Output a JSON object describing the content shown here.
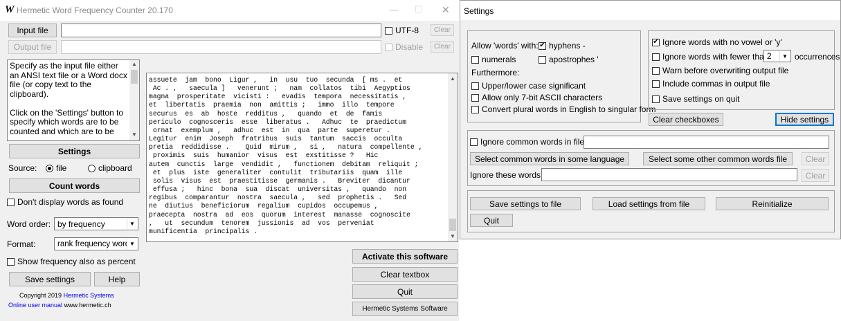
{
  "main_window": {
    "title": "Hermetic Word Frequency Counter 20.170",
    "app_icon_glyph": "W",
    "input_file_label": "Input file",
    "output_file_label": "Output file",
    "utf8_label": "UTF-8",
    "disable_label": "Disable",
    "clear_label": "Clear",
    "help_text": "Specify as the input file either an ANSI text file or a Word docx file (or copy text to the clipboard).\n\nClick on the 'Settings' button to specify which words are to be counted and which are to be",
    "settings_button": "Settings",
    "source_label": "Source:",
    "source_file": "file",
    "source_clipboard": "clipboard",
    "count_words_button": "Count words",
    "dont_display_label": "Don't display words as found",
    "word_order_label": "Word order:",
    "word_order_value": "by frequency",
    "format_label": "Format:",
    "format_value": "rank frequency word",
    "show_percent_label": "Show frequency also as percent",
    "save_settings_button": "Save settings",
    "help_button": "Help",
    "copyright_prefix": "Copyright 2019",
    "copyright_link": "Hermetic Systems",
    "manual_link": "Online user manual",
    "website": "www.hermetic.ch",
    "text_lines": [
      "assuete  jam  bono  Ligur ,   in  usu  tuo  secunda  [ ms .  et",
      " Ac . ,   saecula ]   venerunt ;   nam  collatos  tibi  Aegyptios",
      "magna  prosperitate  vicisti :   evadis  tempora  necessitatis ,",
      "et  libertatis  praemia  non  amittis ;   immo  illo  tempore",
      "securus  es  ab  hoste  redditus ,   quando  et  de  famis",
      "periculo  cognosceris  esse  liberatus .   Adhuc  te  praedictum",
      " ornat  exemplum ,   adhuc  est  in  qua  parte  superetur .",
      "Legitur  enim  Joseph  fratribus  suis  tantum  saccis  occulta",
      "pretia  reddidisse .    Quid  mirum ,   si ,   natura  compellente ,",
      " proximis  suis  humanior  visus  est  exstitisse ?   Hic",
      "autem  cunctis  large  vendidit ,   functionem  debitam  reliquit ;",
      " et  plus  iste  generaliter  contulit  tributariis  quam  ille",
      " solis  visus  est  praestitisse  germanis .   Breviter  dicantur",
      " effusa ;   hinc  bona  sua  discat  universitas ,   quando  non",
      "regibus  comparantur  nostra  saecula ,   sed  prophetis .   Sed",
      "ne  diutius  beneficiorum  regalium  cupidos  occupemus ,",
      "praecepta  nostra  ad  eos  quorum  interest  manasse  cognoscite",
      ",   ut  secundum  tenorem  jussionis  ad  vos  perveniat",
      "munificentia  principalis ."
    ],
    "activate_button": "Activate this software",
    "clear_textbox_button": "Clear textbox",
    "quit_button": "Quit",
    "hss_button": "Hermetic Systems Software"
  },
  "settings_window": {
    "title": "Settings",
    "allow_words_label": "Allow 'words' with:",
    "hyphens_label": "hyphens -",
    "numerals_label": "numerals",
    "apostrophes_label": "apostrophes '",
    "furthermore_label": "Furthermore:",
    "case_label": "Upper/lower case significant",
    "ascii_label": "Allow only 7-bit ASCII characters",
    "plural_label": "Convert plural words in English to singular form",
    "ignore_no_vowel_label": "Ignore words with no vowel or 'y'",
    "ignore_fewer_label": "Ignore words with fewer than",
    "occurrences_value": "2",
    "occurrences_label": "occurrences",
    "warn_label": "Warn before overwriting output file",
    "commas_label": "Include commas in output file",
    "save_on_quit_label": "Save settings on quit",
    "clear_checkboxes_button": "Clear checkboxes",
    "hide_settings_button": "Hide settings",
    "ignore_common_label": "Ignore common words in file:",
    "select_common_lang_button": "Select common words in some language",
    "select_other_file_button": "Select some other common words file",
    "clear_label": "Clear",
    "ignore_these_label": "Ignore these words:",
    "save_to_file_button": "Save settings to file",
    "load_from_file_button": "Load settings from file",
    "reinitialize_button": "Reinitialize",
    "quit_button": "Quit"
  },
  "colors": {
    "window_bg": "#f0f0f0",
    "link": "#0000ee",
    "focus": "#0078d7"
  },
  "icons": {
    "minimize": "—",
    "maximize": "☐",
    "close": "✕",
    "dropdown": "▼",
    "scroll_up": "▲",
    "scroll_down": "▼",
    "check": "✔"
  }
}
